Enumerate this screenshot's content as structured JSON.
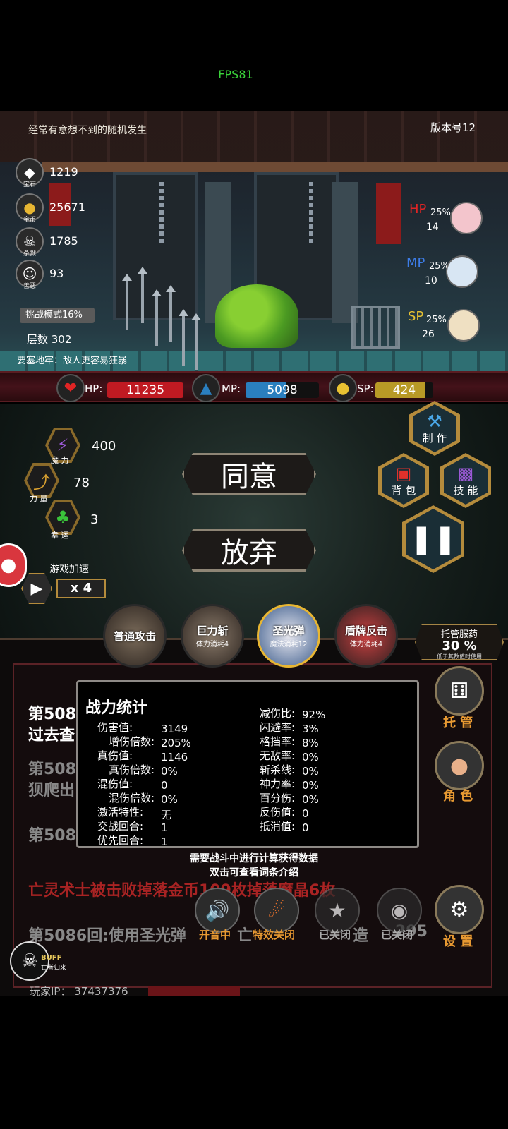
{
  "status": {
    "fps": "FPS81"
  },
  "top": {
    "tagline": "经常有意想不到的随机发生",
    "version": "版本号12"
  },
  "resources": [
    {
      "icon": "gem-icon",
      "sub": "宝石",
      "value": "1219"
    },
    {
      "icon": "gold-coin-icon",
      "sub": "金币",
      "value": "25671"
    },
    {
      "icon": "skull-icon",
      "sub": "杀戮",
      "value": "1785"
    },
    {
      "icon": "mask-icon",
      "sub": "善恶",
      "value": "93"
    }
  ],
  "mode": {
    "challenge": "挑战模式16%",
    "floor": "层数 302",
    "fortress": "要塞地牢：敌人更容易狂暴"
  },
  "potions": [
    {
      "name": "HP",
      "pct": "25%",
      "count": "14",
      "color": "#e02424"
    },
    {
      "name": "MP",
      "pct": "25%",
      "count": "10",
      "color": "#3d7de8"
    },
    {
      "name": "SP",
      "pct": "25%",
      "count": "26",
      "color": "#e8c232"
    }
  ],
  "bars": {
    "hp": {
      "label": "HP:",
      "value": "11235",
      "fill": 1.0,
      "color": "#c01a22"
    },
    "mp": {
      "label": "MP:",
      "value": "5098",
      "fill": 0.55,
      "color": "#2a7fbf"
    },
    "sp": {
      "label": "SP:",
      "value": "424",
      "fill": 0.85,
      "color": "#b89a26"
    }
  },
  "attributes": [
    {
      "icon": "magic-icon",
      "label": "魔 力",
      "value": "400"
    },
    {
      "icon": "strength-icon",
      "label": "力 量",
      "value": "78"
    },
    {
      "icon": "clover-icon",
      "label": "幸 运",
      "value": "3"
    }
  ],
  "dialog": {
    "agree": "同意",
    "abandon": "放弃"
  },
  "menu": {
    "craft": "制 作",
    "bag": "背 包",
    "skill": "技 能"
  },
  "speed": {
    "label": "游戏加速",
    "mult": "x 4"
  },
  "skills": [
    {
      "name": "普通攻击",
      "cost": ""
    },
    {
      "name": "巨力斩",
      "cost": "体力消耗4"
    },
    {
      "name": "圣光弹",
      "cost": "魔法消耗12"
    },
    {
      "name": "盾牌反击",
      "cost": "体力消耗4"
    }
  ],
  "auto_med": {
    "title": "托管服药",
    "value": "30 %",
    "note": "低于其数值时使用"
  },
  "log": {
    "lines": [
      "第508",
      "过去查",
      "第508",
      "狈爬出",
      "第508",
      "亡灵术士被击败掉落金币109枚掉落魔晶6枚",
      "第5086回:使用圣光弹"
    ],
    "fragment1": "亡",
    "fragment2": "造",
    "fragment3": "295"
  },
  "stats": {
    "title": "战力统计",
    "left": [
      {
        "k": "伤害值:",
        "v": "3149"
      },
      {
        "k": "增伤倍数:",
        "v": "205%"
      },
      {
        "k": "真伤值:",
        "v": "1146"
      },
      {
        "k": "真伤倍数:",
        "v": "0%"
      },
      {
        "k": "混伤值:",
        "v": "0"
      },
      {
        "k": "混伤倍数:",
        "v": "0%"
      },
      {
        "k": "激活特性:",
        "v": "无"
      },
      {
        "k": "交战回合:",
        "v": "1"
      },
      {
        "k": "优先回合:",
        "v": "1"
      }
    ],
    "right": [
      {
        "k": "减伤比:",
        "v": "92%"
      },
      {
        "k": "闪避率:",
        "v": "3%"
      },
      {
        "k": "格挡率:",
        "v": "8%"
      },
      {
        "k": "无敌率:",
        "v": "0%"
      },
      {
        "k": "斩杀线:",
        "v": "0%"
      },
      {
        "k": "神力率:",
        "v": "0%"
      },
      {
        "k": "百分伤:",
        "v": "0%"
      },
      {
        "k": "反伤值:",
        "v": "0"
      },
      {
        "k": "抵消值:",
        "v": "0"
      }
    ],
    "hint1": "需要战斗中进行计算获得数据",
    "hint2": "双击可查看词条介绍"
  },
  "right_menu": {
    "auto": "托 管",
    "role": "角 色",
    "settings": "设 置"
  },
  "toggles": [
    {
      "label": "开音中",
      "color": "#e89a32"
    },
    {
      "label": "特效关闭",
      "color": "#e89a32"
    },
    {
      "label": "已关闭",
      "color": "#aaaaaa"
    },
    {
      "label": "已关闭",
      "color": "#aaaaaa"
    }
  ],
  "buff": {
    "title": "BUFF",
    "sub": "亡者归来"
  },
  "player": {
    "ip": "玩家IP：  37437376"
  }
}
